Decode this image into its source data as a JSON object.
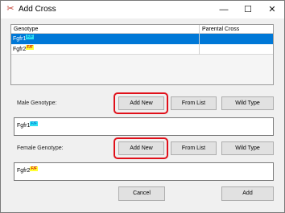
{
  "window": {
    "title": "Add Cross",
    "icon": "cross-icon",
    "controls": {
      "minimize": "—",
      "maximize": "☐",
      "close": "✕"
    }
  },
  "grid": {
    "headers": [
      "Genotype",
      "Parental Cross"
    ],
    "rows": [
      {
        "gene": "Fgfr1",
        "allele": "F/F",
        "parental_cross": "",
        "selected": true
      },
      {
        "gene": "Fgfr2",
        "allele": "F/F",
        "parental_cross": "",
        "selected": false
      }
    ]
  },
  "male": {
    "label": "Male Genotype:",
    "add_new": "Add New",
    "from_list": "From List",
    "wild_type": "Wild Type",
    "value_gene": "Fgfr1",
    "value_allele": "F/F"
  },
  "female": {
    "label": "Female Genotype:",
    "add_new": "Add New",
    "from_list": "From List",
    "wild_type": "Wild Type",
    "value_gene": "Fgfr2",
    "value_allele": "F/F"
  },
  "footer": {
    "cancel": "Cancel",
    "add": "Add"
  },
  "colors": {
    "selection": "#0078d7",
    "highlight": "#e0101a",
    "allele_cyan": "#2ee0f0",
    "allele_yellow": "#ffff33"
  }
}
